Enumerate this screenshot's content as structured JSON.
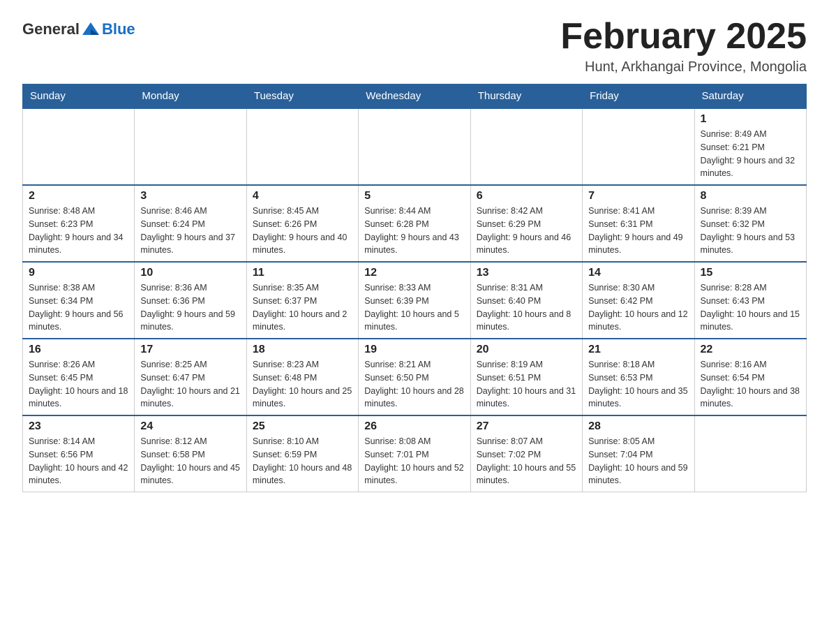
{
  "header": {
    "logo_general": "General",
    "logo_blue": "Blue",
    "month_title": "February 2025",
    "location": "Hunt, Arkhangai Province, Mongolia"
  },
  "weekdays": [
    "Sunday",
    "Monday",
    "Tuesday",
    "Wednesday",
    "Thursday",
    "Friday",
    "Saturday"
  ],
  "weeks": [
    {
      "days": [
        {
          "number": "",
          "info": ""
        },
        {
          "number": "",
          "info": ""
        },
        {
          "number": "",
          "info": ""
        },
        {
          "number": "",
          "info": ""
        },
        {
          "number": "",
          "info": ""
        },
        {
          "number": "",
          "info": ""
        },
        {
          "number": "1",
          "info": "Sunrise: 8:49 AM\nSunset: 6:21 PM\nDaylight: 9 hours and 32 minutes."
        }
      ]
    },
    {
      "days": [
        {
          "number": "2",
          "info": "Sunrise: 8:48 AM\nSunset: 6:23 PM\nDaylight: 9 hours and 34 minutes."
        },
        {
          "number": "3",
          "info": "Sunrise: 8:46 AM\nSunset: 6:24 PM\nDaylight: 9 hours and 37 minutes."
        },
        {
          "number": "4",
          "info": "Sunrise: 8:45 AM\nSunset: 6:26 PM\nDaylight: 9 hours and 40 minutes."
        },
        {
          "number": "5",
          "info": "Sunrise: 8:44 AM\nSunset: 6:28 PM\nDaylight: 9 hours and 43 minutes."
        },
        {
          "number": "6",
          "info": "Sunrise: 8:42 AM\nSunset: 6:29 PM\nDaylight: 9 hours and 46 minutes."
        },
        {
          "number": "7",
          "info": "Sunrise: 8:41 AM\nSunset: 6:31 PM\nDaylight: 9 hours and 49 minutes."
        },
        {
          "number": "8",
          "info": "Sunrise: 8:39 AM\nSunset: 6:32 PM\nDaylight: 9 hours and 53 minutes."
        }
      ]
    },
    {
      "days": [
        {
          "number": "9",
          "info": "Sunrise: 8:38 AM\nSunset: 6:34 PM\nDaylight: 9 hours and 56 minutes."
        },
        {
          "number": "10",
          "info": "Sunrise: 8:36 AM\nSunset: 6:36 PM\nDaylight: 9 hours and 59 minutes."
        },
        {
          "number": "11",
          "info": "Sunrise: 8:35 AM\nSunset: 6:37 PM\nDaylight: 10 hours and 2 minutes."
        },
        {
          "number": "12",
          "info": "Sunrise: 8:33 AM\nSunset: 6:39 PM\nDaylight: 10 hours and 5 minutes."
        },
        {
          "number": "13",
          "info": "Sunrise: 8:31 AM\nSunset: 6:40 PM\nDaylight: 10 hours and 8 minutes."
        },
        {
          "number": "14",
          "info": "Sunrise: 8:30 AM\nSunset: 6:42 PM\nDaylight: 10 hours and 12 minutes."
        },
        {
          "number": "15",
          "info": "Sunrise: 8:28 AM\nSunset: 6:43 PM\nDaylight: 10 hours and 15 minutes."
        }
      ]
    },
    {
      "days": [
        {
          "number": "16",
          "info": "Sunrise: 8:26 AM\nSunset: 6:45 PM\nDaylight: 10 hours and 18 minutes."
        },
        {
          "number": "17",
          "info": "Sunrise: 8:25 AM\nSunset: 6:47 PM\nDaylight: 10 hours and 21 minutes."
        },
        {
          "number": "18",
          "info": "Sunrise: 8:23 AM\nSunset: 6:48 PM\nDaylight: 10 hours and 25 minutes."
        },
        {
          "number": "19",
          "info": "Sunrise: 8:21 AM\nSunset: 6:50 PM\nDaylight: 10 hours and 28 minutes."
        },
        {
          "number": "20",
          "info": "Sunrise: 8:19 AM\nSunset: 6:51 PM\nDaylight: 10 hours and 31 minutes."
        },
        {
          "number": "21",
          "info": "Sunrise: 8:18 AM\nSunset: 6:53 PM\nDaylight: 10 hours and 35 minutes."
        },
        {
          "number": "22",
          "info": "Sunrise: 8:16 AM\nSunset: 6:54 PM\nDaylight: 10 hours and 38 minutes."
        }
      ]
    },
    {
      "days": [
        {
          "number": "23",
          "info": "Sunrise: 8:14 AM\nSunset: 6:56 PM\nDaylight: 10 hours and 42 minutes."
        },
        {
          "number": "24",
          "info": "Sunrise: 8:12 AM\nSunset: 6:58 PM\nDaylight: 10 hours and 45 minutes."
        },
        {
          "number": "25",
          "info": "Sunrise: 8:10 AM\nSunset: 6:59 PM\nDaylight: 10 hours and 48 minutes."
        },
        {
          "number": "26",
          "info": "Sunrise: 8:08 AM\nSunset: 7:01 PM\nDaylight: 10 hours and 52 minutes."
        },
        {
          "number": "27",
          "info": "Sunrise: 8:07 AM\nSunset: 7:02 PM\nDaylight: 10 hours and 55 minutes."
        },
        {
          "number": "28",
          "info": "Sunrise: 8:05 AM\nSunset: 7:04 PM\nDaylight: 10 hours and 59 minutes."
        },
        {
          "number": "",
          "info": ""
        }
      ]
    }
  ]
}
